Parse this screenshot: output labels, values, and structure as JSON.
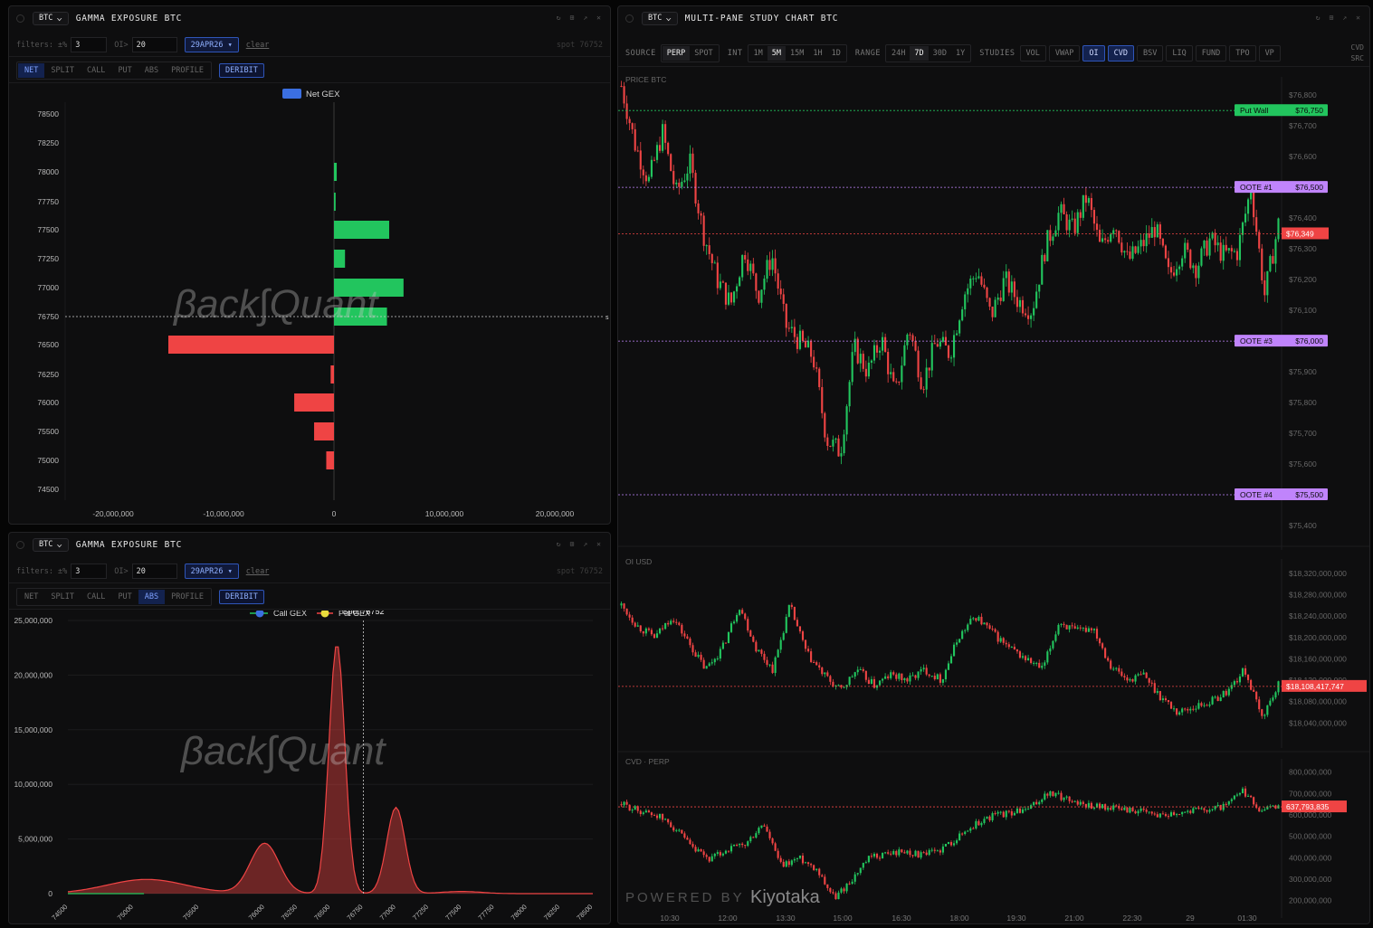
{
  "brand": {
    "watermark_left": "βack∫Quant",
    "powered": "POWERED BY",
    "powered_brand": "Kiyotaka"
  },
  "panel_top": {
    "symbol": "BTC",
    "title": "GAMMA EXPOSURE BTC",
    "filters": {
      "pct_label": "filters: ±%",
      "pct_value": "3",
      "oi_label": "OI>",
      "oi_value": "20",
      "date": "29APR26 ▾",
      "clear": "clear",
      "spot": "spot 76752"
    },
    "tabs": [
      "NET",
      "SPLIT",
      "CALL",
      "PUT",
      "ABS",
      "PROFILE"
    ],
    "active_tab": "NET",
    "exchange": "DERIBIT"
  },
  "panel_bottom": {
    "symbol": "BTC",
    "title": "GAMMA EXPOSURE BTC",
    "filters": {
      "pct_label": "filters: ±%",
      "pct_value": "3",
      "oi_label": "OI>",
      "oi_value": "20",
      "date": "29APR26 ▾",
      "clear": "clear",
      "spot": "spot 76752"
    },
    "tabs": [
      "NET",
      "SPLIT",
      "CALL",
      "PUT",
      "ABS",
      "PROFILE"
    ],
    "active_tab": "ABS",
    "exchange": "DERIBIT"
  },
  "panel_right": {
    "symbol": "BTC",
    "title": "MULTI-PANE STUDY CHART BTC",
    "toolbar": {
      "source_label": "SOURCE",
      "sources": [
        "PERP",
        "SPOT"
      ],
      "source_active": "PERP",
      "int_label": "INT",
      "intervals": [
        "1M",
        "5M",
        "15M",
        "1H",
        "1D"
      ],
      "int_active": "5M",
      "range_label": "RANGE",
      "ranges": [
        "24H",
        "7D",
        "30D",
        "1Y"
      ],
      "range_active": "7D",
      "studies_label": "STUDIES",
      "studies": [
        "VOL",
        "VWAP",
        "OI",
        "CVD",
        "BSV",
        "LIQ",
        "FUND",
        "TPO",
        "VP"
      ],
      "studies_active": [
        "OI",
        "CVD"
      ],
      "cvd_src": [
        "CVD",
        "SRC"
      ]
    }
  },
  "chart_data": [
    {
      "type": "bar",
      "orientation": "horizontal",
      "legend": [
        "Net GEX"
      ],
      "legend_position": "top-center",
      "categories": [
        78500,
        78250,
        78000,
        77750,
        77500,
        77250,
        77000,
        76750,
        76500,
        76250,
        76000,
        75500,
        75000,
        74500
      ],
      "values": [
        0,
        0,
        250000,
        150000,
        5000000,
        1000000,
        6300000,
        4800000,
        -15000000,
        -300000,
        -3600000,
        -1800000,
        -700000,
        0
      ],
      "xticks": [
        "-20,000,000",
        "-10,000,000",
        "0",
        "10,000,000",
        "20,000,000"
      ],
      "xlim": [
        -24000000,
        24000000
      ],
      "spot": 76752,
      "spot_marker": "s",
      "colors": {
        "positive": "#22c55e",
        "negative": "#ef4444",
        "legend": "#3b6fe0"
      }
    },
    {
      "type": "area",
      "legend": [
        "Call GEX",
        "Put GEX"
      ],
      "spot_label": "Spot 76752",
      "spot": 76752,
      "x": [
        74500,
        75000,
        75500,
        76000,
        76250,
        76500,
        76750,
        77000,
        77250,
        77500,
        77750,
        78000,
        78250,
        78500
      ],
      "xticks": [
        "74500",
        "75000",
        "75500",
        "76000",
        "76250",
        "76500",
        "76750",
        "77000",
        "77250",
        "77500",
        "77750",
        "78000",
        "78250",
        "78500"
      ],
      "yticks": [
        "0",
        "5,000,000",
        "10,000,000",
        "15,000,000",
        "20,000,000",
        "25,000,000"
      ],
      "ylim": [
        0,
        25000000
      ],
      "series": [
        {
          "name": "Call GEX",
          "color": "#22c55e",
          "peaks": [
            [
              75100,
              0,
              0
            ],
            [
              76000,
              1200000,
              140
            ],
            [
              76500,
              7900000,
              95
            ],
            [
              77000,
              14300000,
              90
            ],
            [
              77500,
              5800000,
              95
            ],
            [
              78000,
              100000,
              200
            ]
          ]
        },
        {
          "name": "Put GEX",
          "color": "#ef4444",
          "peaks": [
            [
              75100,
              1300000,
              300
            ],
            [
              76000,
              4600000,
              110
            ],
            [
              76550,
              22900000,
              60
            ],
            [
              77000,
              7900000,
              70
            ],
            [
              77500,
              200000,
              150
            ]
          ]
        }
      ]
    },
    {
      "type": "candlestick",
      "pane": "PRICE BTC",
      "ylim": [
        75350,
        76830
      ],
      "yticks": [
        "$76,800",
        "$76,700",
        "$76,600",
        "$76,500",
        "$76,400",
        "$76,300",
        "$76,200",
        "$76,100",
        "$76,000",
        "$75,900",
        "$75,800",
        "$75,700",
        "$75,600",
        "$75,500",
        "$75,400"
      ],
      "xticks": [
        "10:30",
        "12:00",
        "13:30",
        "15:00",
        "16:30",
        "18:00",
        "19:30",
        "21:00",
        "22:30",
        "29",
        "01:30"
      ],
      "levels": [
        {
          "label": "Put Wall",
          "value": "$76,750",
          "price": 76750,
          "color": "#22c55e"
        },
        {
          "label": "OOTE #1",
          "value": "$76,500",
          "price": 76500,
          "color": "#c084fc"
        },
        {
          "label": "OOTE #3",
          "value": "$76,000",
          "price": 76000,
          "color": "#c084fc"
        },
        {
          "label": "OOTE #4",
          "value": "$75,500",
          "price": 75500,
          "color": "#c084fc"
        }
      ],
      "last": {
        "price": 76349,
        "label": "$76,349"
      },
      "path": [
        76830,
        76640,
        76520,
        76680,
        76480,
        76580,
        76350,
        76200,
        76120,
        76300,
        76150,
        76280,
        76050,
        76000,
        75950,
        75680,
        75640,
        75980,
        75900,
        76010,
        75820,
        76050,
        75860,
        76000,
        75960,
        76150,
        76230,
        76080,
        76200,
        76130,
        76100,
        76310,
        76420,
        76360,
        76470,
        76300,
        76390,
        76260,
        76310,
        76370,
        76210,
        76300,
        76240,
        76330,
        76280,
        76290,
        76500,
        76150,
        76380
      ]
    },
    {
      "type": "candlestick",
      "pane": "OI USD",
      "ylim": [
        18010000000,
        18330000000
      ],
      "yticks": [
        "$18,320,000,000",
        "$18,280,000,000",
        "$18,240,000,000",
        "$18,200,000,000",
        "$18,160,000,000",
        "$18,120,000,000",
        "$18,080,000,000",
        "$18,040,000,000"
      ],
      "last": {
        "value": 18108417747,
        "label": "$18,108,417,747"
      },
      "path": [
        18260000000,
        18220000000,
        18200000000,
        18240000000,
        18190000000,
        18140000000,
        18180000000,
        18260000000,
        18180000000,
        18140000000,
        18260000000,
        18170000000,
        18130000000,
        18100000000,
        18140000000,
        18110000000,
        18130000000,
        18120000000,
        18140000000,
        18120000000,
        18200000000,
        18240000000,
        18210000000,
        18180000000,
        18160000000,
        18140000000,
        18230000000,
        18210000000,
        18220000000,
        18150000000,
        18120000000,
        18130000000,
        18090000000,
        18060000000,
        18070000000,
        18080000000,
        18100000000,
        18140000000,
        18050000000,
        18110000000
      ]
    },
    {
      "type": "candlestick",
      "pane": "CVD · PERP",
      "ylim": [
        160000000,
        820000000
      ],
      "yticks": [
        "800,000,000",
        "700,000,000",
        "600,000,000",
        "500,000,000",
        "400,000,000",
        "300,000,000",
        "200,000,000"
      ],
      "last": {
        "value": 637793835,
        "label": "637,793,835"
      },
      "path": [
        650000000,
        620000000,
        600000000,
        540000000,
        440000000,
        390000000,
        440000000,
        460000000,
        560000000,
        360000000,
        400000000,
        350000000,
        210000000,
        300000000,
        400000000,
        420000000,
        430000000,
        410000000,
        440000000,
        500000000,
        560000000,
        600000000,
        610000000,
        630000000,
        700000000,
        680000000,
        650000000,
        640000000,
        630000000,
        620000000,
        600000000,
        610000000,
        620000000,
        630000000,
        640000000,
        710000000,
        620000000,
        640000000
      ]
    }
  ]
}
